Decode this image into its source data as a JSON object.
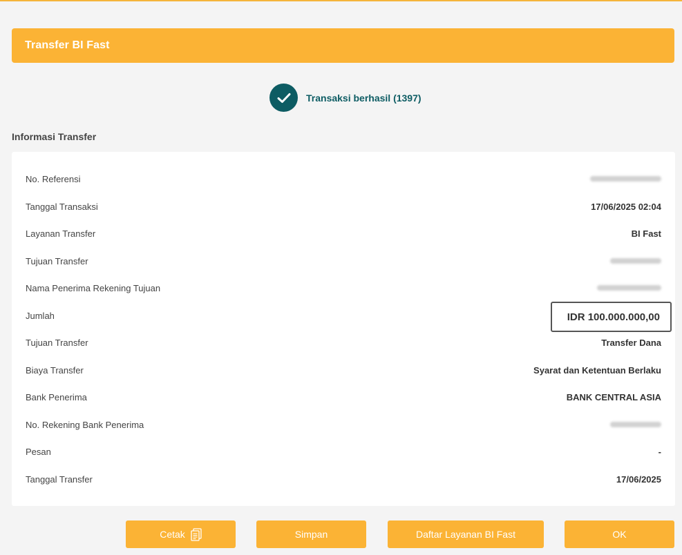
{
  "header": {
    "title": "Transfer BI Fast"
  },
  "status": {
    "text": "Transaksi berhasil (1397)",
    "icon": "check-icon",
    "color": "#0d5c63"
  },
  "section": {
    "title": "Informasi Transfer"
  },
  "info_rows": [
    {
      "label": "No. Referensi",
      "value": "",
      "blurred": true
    },
    {
      "label": "Tanggal Transaksi",
      "value": "17/06/2025 02:04"
    },
    {
      "label": "Layanan Transfer",
      "value": "BI Fast"
    },
    {
      "label": "Tujuan Transfer",
      "value": "",
      "blurred": true
    },
    {
      "label": "Nama Penerima Rekening Tujuan",
      "value": "",
      "blurred": true
    },
    {
      "label": "Jumlah",
      "value": "IDR 100.000.000,00",
      "highlighted": true
    },
    {
      "label": "Tujuan Transfer",
      "value": "Transfer Dana"
    },
    {
      "label": "Biaya Transfer",
      "value": "Syarat dan Ketentuan Berlaku"
    },
    {
      "label": "Bank Penerima",
      "value": "BANK CENTRAL ASIA"
    },
    {
      "label": "No. Rekening Bank Penerima",
      "value": "",
      "blurred": true
    },
    {
      "label": "Pesan",
      "value": "-"
    },
    {
      "label": "Tanggal Transfer",
      "value": "17/06/2025"
    }
  ],
  "buttons": {
    "print_label": "Cetak",
    "print_icon": "document-icon",
    "save_label": "Simpan",
    "list_label": "Daftar Layanan BI Fast",
    "ok_label": "OK"
  },
  "colors": {
    "accent": "#fbb335",
    "status": "#0d5c63"
  }
}
